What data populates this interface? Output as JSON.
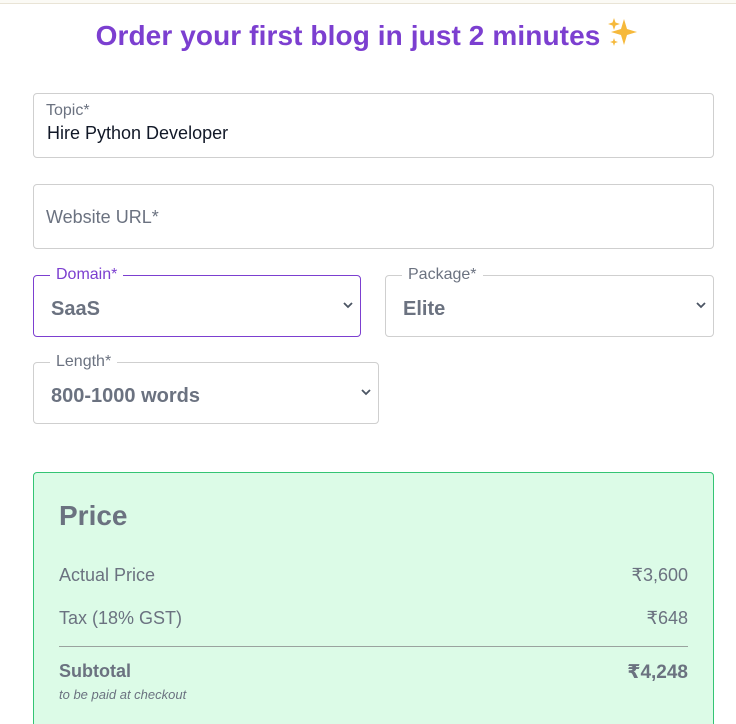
{
  "header": {
    "title": "Order your first blog in just 2 minutes"
  },
  "form": {
    "topic": {
      "label": "Topic*",
      "value": "Hire Python Developer"
    },
    "website": {
      "placeholder": "Website URL*"
    },
    "domain": {
      "label": "Domain*",
      "value": "SaaS"
    },
    "package": {
      "label": "Package*",
      "value": "Elite"
    },
    "length": {
      "label": "Length*",
      "value": "800-1000 words"
    }
  },
  "price": {
    "title": "Price",
    "actual_label": "Actual Price",
    "actual_value": "₹3,600",
    "tax_label": "Tax (18% GST)",
    "tax_value": "₹648",
    "subtotal_label": "Subtotal",
    "subtotal_value": "₹4,248",
    "note": "to be paid at checkout"
  },
  "colors": {
    "accent": "#7c3fd0",
    "price_bg": "#dcfbe7",
    "price_border": "#34c474"
  },
  "icons": {
    "sparkle": "sparkles-icon",
    "select": "chevron-down-icon"
  }
}
